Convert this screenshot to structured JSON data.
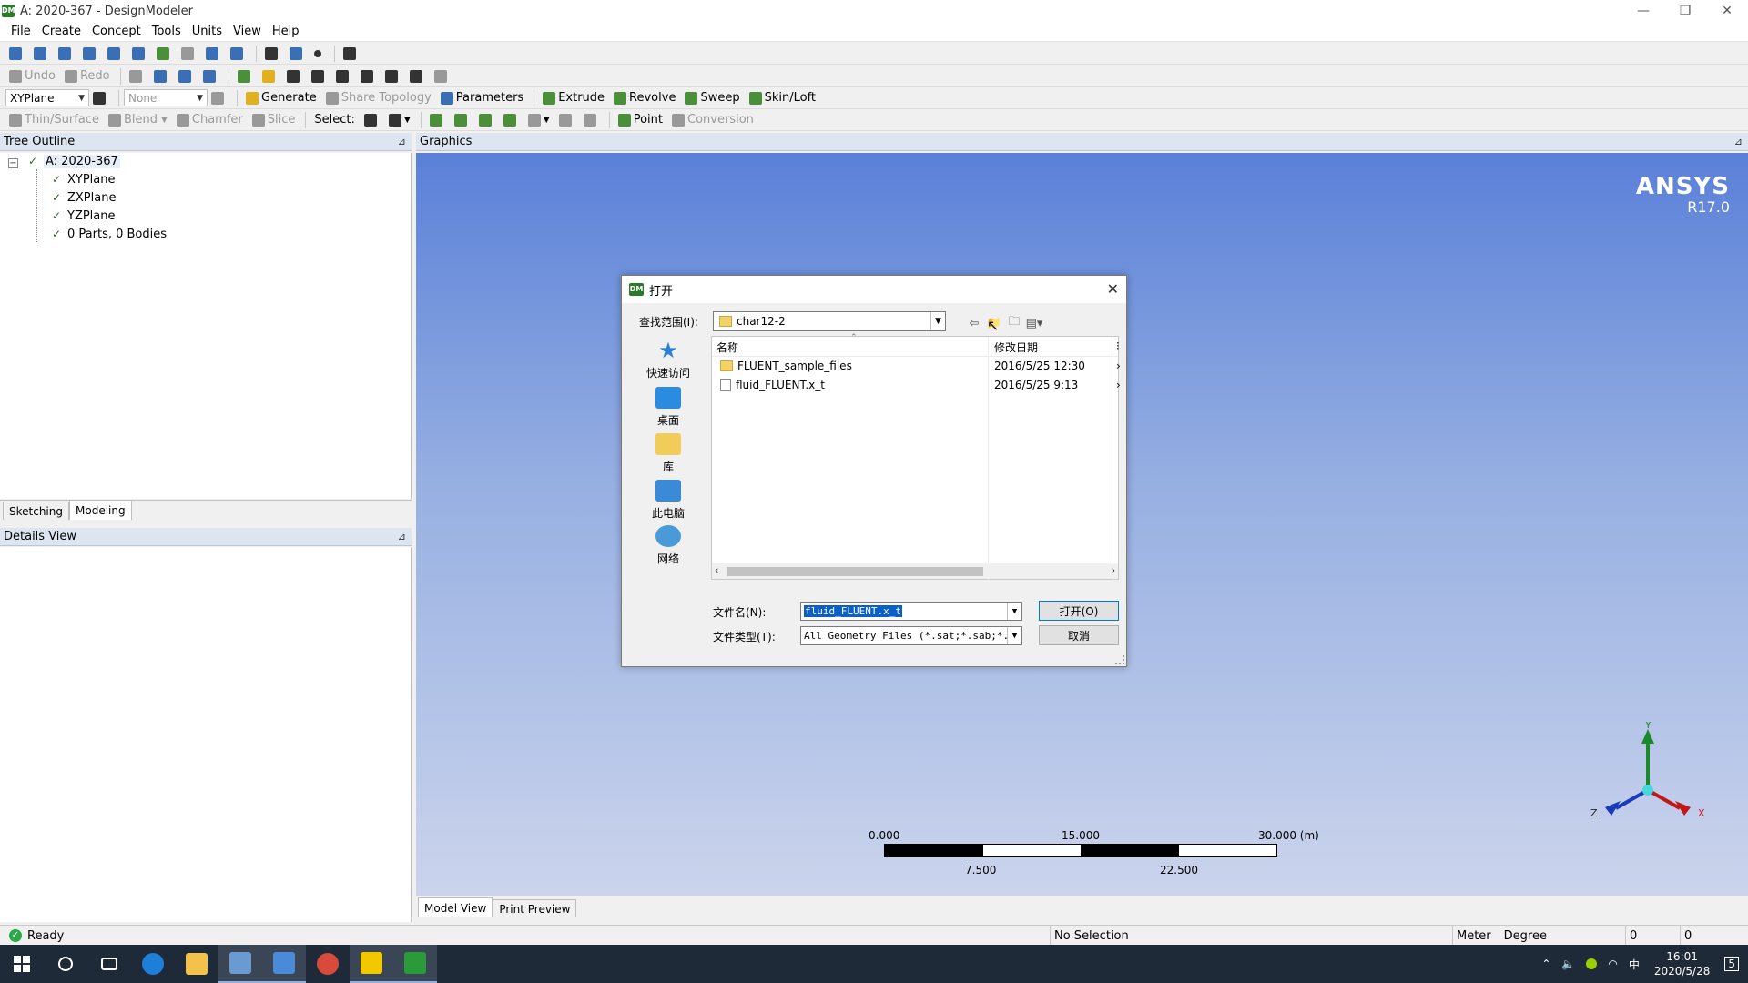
{
  "window": {
    "title": "A: 2020-367 - DesignModeler",
    "app_icon": "DM",
    "controls": [
      "—",
      "❐",
      "✕"
    ]
  },
  "menu": [
    "File",
    "Create",
    "Concept",
    "Tools",
    "Units",
    "View",
    "Help"
  ],
  "toolbar2": {
    "undo": "Undo",
    "redo": "Redo"
  },
  "toolbar3": {
    "plane": "XYPlane",
    "sketch": "None",
    "generate": "Generate",
    "share_topology": "Share Topology",
    "parameters": "Parameters",
    "extrude": "Extrude",
    "revolve": "Revolve",
    "sweep": "Sweep",
    "skin_loft": "Skin/Loft"
  },
  "toolbar4": {
    "thin_surface": "Thin/Surface",
    "blend": "Blend",
    "chamfer": "Chamfer",
    "slice": "Slice",
    "select_label": "Select:",
    "point": "Point",
    "conversion": "Conversion"
  },
  "tree": {
    "header": "Tree Outline",
    "root": "A: 2020-367",
    "items": [
      "XYPlane",
      "ZXPlane",
      "YZPlane",
      "0 Parts, 0 Bodies"
    ]
  },
  "tabs": {
    "sketching": "Sketching",
    "modeling": "Modeling"
  },
  "details": {
    "header": "Details View"
  },
  "graphics": {
    "header": "Graphics",
    "logo_name": "ANSYS",
    "logo_version": "R17.0",
    "scale_top": [
      "0.000",
      "15.000",
      "30.000 (m)"
    ],
    "scale_bottom": [
      "7.500",
      "22.500"
    ],
    "axes": {
      "x": "X",
      "y": "Y",
      "z": "Z"
    }
  },
  "view_tabs": {
    "model_view": "Model View",
    "print_preview": "Print Preview"
  },
  "status": {
    "ready": "Ready",
    "selection": "No Selection",
    "unit_length": "Meter",
    "unit_angle": "Degree",
    "val1": "0",
    "val2": "0"
  },
  "dialog": {
    "title": "打开",
    "look_in_label": "查找范围(I):",
    "look_in_value": "char12-2",
    "places": [
      "快速访问",
      "桌面",
      "库",
      "此电脑",
      "网络"
    ],
    "columns": {
      "name": "名称",
      "date": "修改日期"
    },
    "files": [
      {
        "name": "FLUENT_sample_files",
        "date": "2016/5/25 12:30",
        "type": "folder"
      },
      {
        "name": "fluid_FLUENT.x_t",
        "date": "2016/5/25 9:13",
        "type": "file"
      }
    ],
    "filename_label": "文件名(N):",
    "filename_value": "fluid_FLUENT.x_t",
    "filetype_label": "文件类型(T):",
    "filetype_value": "All Geometry Files (*.sat;*.sab;*.pmd",
    "open_button": "打开(O)",
    "cancel_button": "取消"
  },
  "taskbar": {
    "time": "16:01",
    "date": "2020/5/28",
    "ime": "中",
    "notifications": "5"
  }
}
